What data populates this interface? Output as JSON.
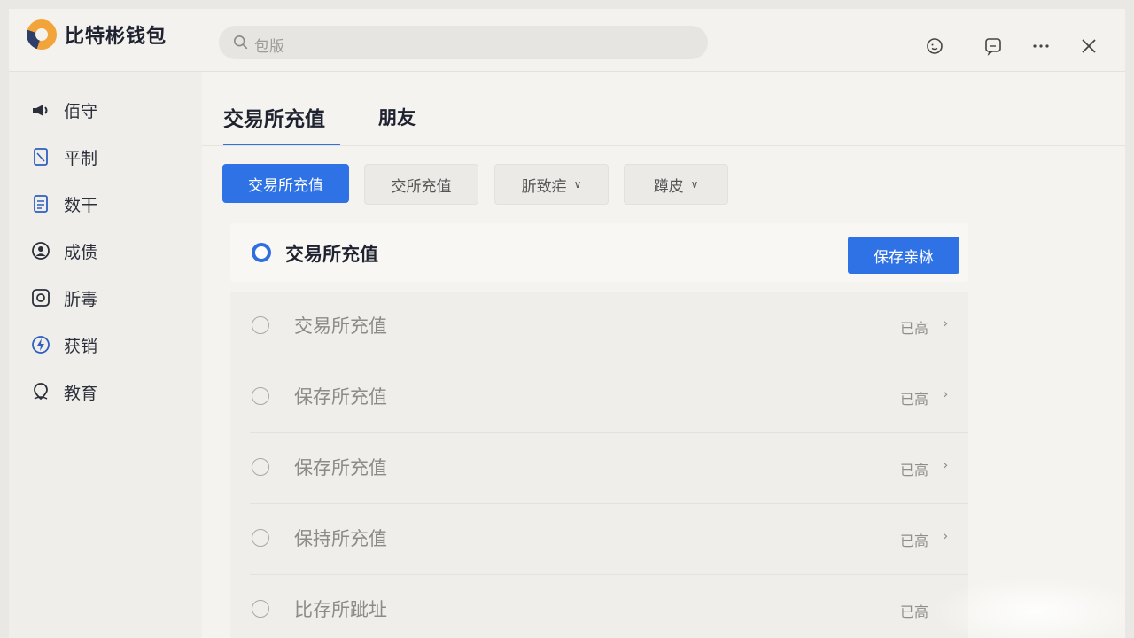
{
  "app": {
    "title": "比特彬钱包",
    "brand_colors": {
      "accent": "#2f72e6",
      "logo_orange": "#f2a43a",
      "logo_navy": "#2f3e66"
    }
  },
  "search": {
    "placeholder": "包版",
    "icon": "search-icon"
  },
  "titlebar_icons": [
    "emoji-icon",
    "chat-icon",
    "more-icon",
    "close-icon"
  ],
  "sidebar": {
    "items": [
      {
        "label": "佰守",
        "icon": "megaphone-icon"
      },
      {
        "label": "平制",
        "icon": "tag-icon"
      },
      {
        "label": "数干",
        "icon": "document-icon"
      },
      {
        "label": "成债",
        "icon": "user-circle-icon"
      },
      {
        "label": "肵毒",
        "icon": "camera-icon"
      },
      {
        "label": "获销",
        "icon": "lightning-icon"
      },
      {
        "label": "教育",
        "icon": "location-icon"
      }
    ]
  },
  "main": {
    "tabs": [
      {
        "label": "交易所充值",
        "active": true
      },
      {
        "label": "朋友",
        "active": false
      }
    ],
    "filters": [
      {
        "label": "交易所充值",
        "selected": true
      },
      {
        "label": "交所充值",
        "selected": false
      },
      {
        "label": "肵致疟",
        "selected": false,
        "dropdown": true
      },
      {
        "label": "蹲皮",
        "selected": false,
        "dropdown": true
      }
    ],
    "selected_card": {
      "title": "交易所充值",
      "button": "保存亲栤"
    },
    "rows": [
      {
        "label": "交易所充值",
        "status": "已高"
      },
      {
        "label": "保存所充值",
        "status": "已高"
      },
      {
        "label": "保存所充值",
        "status": "已高"
      },
      {
        "label": "保持所充值",
        "status": "已高"
      },
      {
        "label": "比存所跐址",
        "status": "已高"
      }
    ]
  }
}
